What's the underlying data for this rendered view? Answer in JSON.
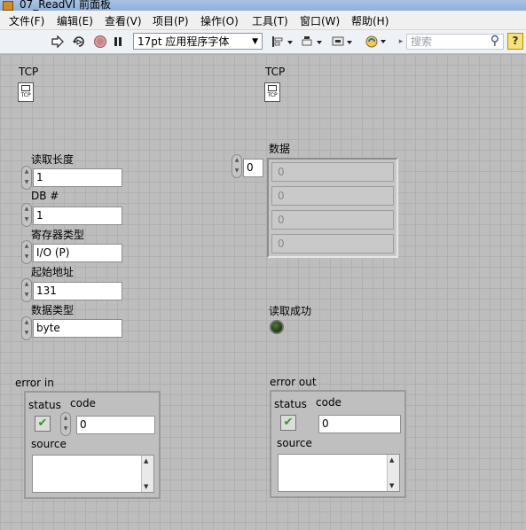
{
  "window": {
    "title": "07_ReadVI 前面板"
  },
  "menu": [
    "文件(F)",
    "编辑(E)",
    "查看(V)",
    "项目(P)",
    "操作(O)",
    "工具(T)",
    "窗口(W)",
    "帮助(H)"
  ],
  "toolbar": {
    "font_value": "17pt 应用程序字体",
    "search_placeholder": "搜索",
    "help_glyph": "?"
  },
  "panel": {
    "tcp_left": {
      "label": "TCP",
      "icon_text": "TCP"
    },
    "tcp_right": {
      "label": "TCP",
      "icon_text": "TCP"
    },
    "read_length": {
      "label": "读取长度",
      "value": "1"
    },
    "db_number": {
      "label": "DB #",
      "value": "1"
    },
    "register_type": {
      "label": "寄存器类型",
      "value": "I/O (P)"
    },
    "start_address": {
      "label": "起始地址",
      "value": "131"
    },
    "data_type": {
      "label": "数据类型",
      "value": "byte"
    },
    "data_array": {
      "label": "数据",
      "index": "0",
      "elements": [
        "0",
        "0",
        "0",
        "0"
      ]
    },
    "read_success": {
      "label": "读取成功",
      "state": false
    },
    "error_in": {
      "label": "error in",
      "status_label": "status",
      "code_label": "code",
      "code_value": "0",
      "source_label": "source",
      "source_value": "",
      "status": true
    },
    "error_out": {
      "label": "error out",
      "status_label": "status",
      "code_label": "code",
      "code_value": "0",
      "source_label": "source",
      "source_value": "",
      "status": true
    }
  },
  "colors": {
    "panel_bg": "#bdbdbd",
    "led_off": "#1b3810",
    "check_green": "#2e9c1a",
    "help_yellow": "#f7e27a"
  }
}
